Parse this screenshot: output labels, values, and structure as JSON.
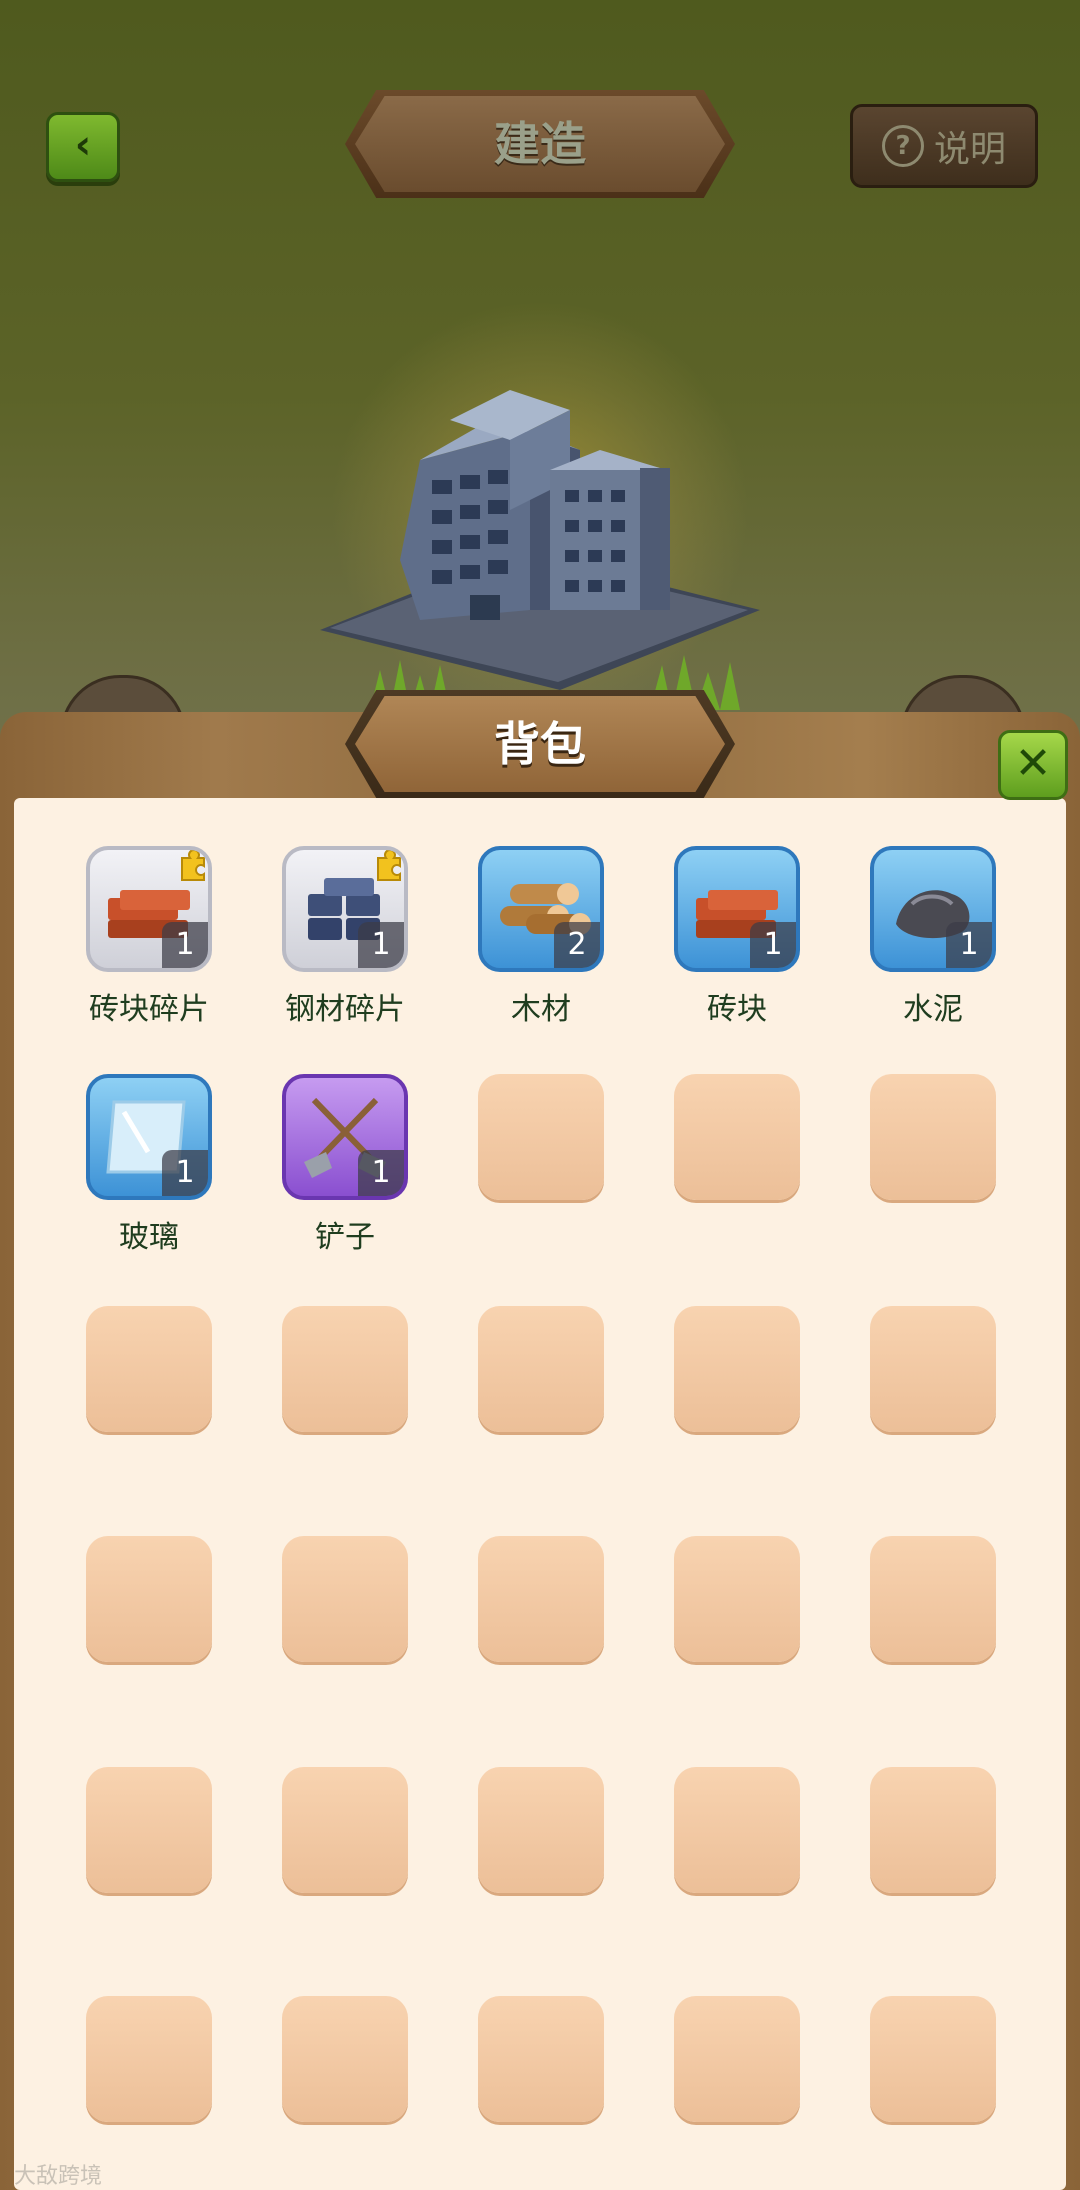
{
  "header": {
    "title": "建造",
    "help_label": "说明"
  },
  "backpack": {
    "title": "背包",
    "items": [
      {
        "name": "砖块碎片",
        "count": "1",
        "frame": "grey",
        "icon": "bricks-icon",
        "fragment": true
      },
      {
        "name": "钢材碎片",
        "count": "1",
        "frame": "grey",
        "icon": "steel-blocks-icon",
        "fragment": true
      },
      {
        "name": "木材",
        "count": "2",
        "frame": "blue",
        "icon": "logs-icon",
        "fragment": false
      },
      {
        "name": "砖块",
        "count": "1",
        "frame": "blue",
        "icon": "bricks-icon",
        "fragment": false
      },
      {
        "name": "水泥",
        "count": "1",
        "frame": "blue",
        "icon": "cement-icon",
        "fragment": false
      },
      {
        "name": "玻璃",
        "count": "1",
        "frame": "blue",
        "icon": "glass-icon",
        "fragment": false
      },
      {
        "name": "铲子",
        "count": "1",
        "frame": "purple",
        "icon": "shovels-icon",
        "fragment": false
      }
    ],
    "total_slots": 30
  },
  "watermark": "大敌跨境"
}
